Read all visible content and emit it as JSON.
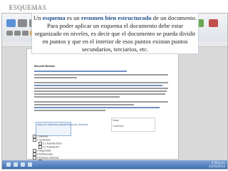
{
  "slide": {
    "title": "ESQUEMAS"
  },
  "callout": {
    "p1": "Un ",
    "b1": "esquema",
    "p2": " es un ",
    "b2": "resumen bien estructurado",
    "p3": " de un documento. Para poder aplicar un esquema el documento debe estar organizado en niveles, es decir que el documento se pueda dividir en puntos y que en el interior de esos puntos existan puntos secundarios, terciarios, etc."
  },
  "document": {
    "heading": "Microsoft Windows",
    "note": "https://es.wikipedia.org/wiki/Microsoft_Windows",
    "side_labels": [
      "Índice",
      "Contenido"
    ],
    "outline": [
      "1 Historia",
      "2 Versiones",
      "2.1 Familia DOS",
      "2.2 Familia NT",
      "3 Seguridad",
      "4 Referencias",
      "5 Enlaces externos",
      "5.1 Noticias",
      "5.2 Recursos"
    ]
  },
  "taskbar": {
    "time": "5:58 p.m.",
    "date": "22/03/2012"
  },
  "colors": {
    "accent": "#1f4f8f",
    "taskbar": "#3f6fae",
    "title_text": "#c8c8c8"
  },
  "icons": [
    "word-app-icon",
    "browser-icon",
    "folder-icon",
    "media-icon"
  ]
}
